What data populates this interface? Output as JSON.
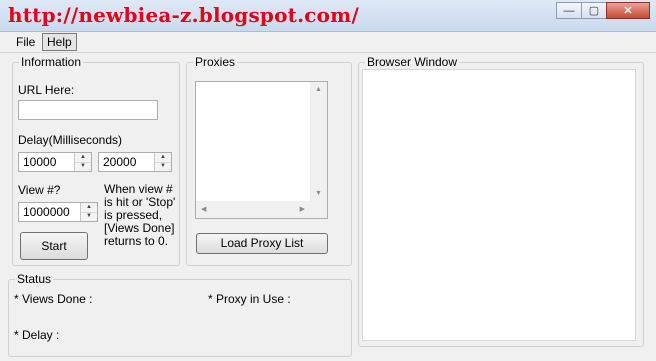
{
  "window": {
    "title": "http://newbiea-z.blogspot.com/",
    "minimize_glyph": "—",
    "maximize_glyph": "▢",
    "close_glyph": "✕"
  },
  "menu": {
    "items": [
      "File",
      "Help"
    ]
  },
  "information": {
    "legend": "Information",
    "url_label": "URL Here:",
    "url_value": "",
    "delay_label": "Delay(Milliseconds)",
    "delay_min": "10000",
    "delay_max": "20000",
    "view_label": "View #?",
    "view_value": "1000000",
    "note": "When view # is hit or 'Stop' is pressed, [Views Done] returns to 0.",
    "start_label": "Start"
  },
  "proxies": {
    "legend": "Proxies",
    "load_label": "Load Proxy List"
  },
  "status": {
    "legend": "Status",
    "views_done": "* Views Done :",
    "proxy_in_use": "* Proxy in Use :",
    "delay": "* Delay :"
  },
  "browser": {
    "legend": "Browser Window"
  }
}
